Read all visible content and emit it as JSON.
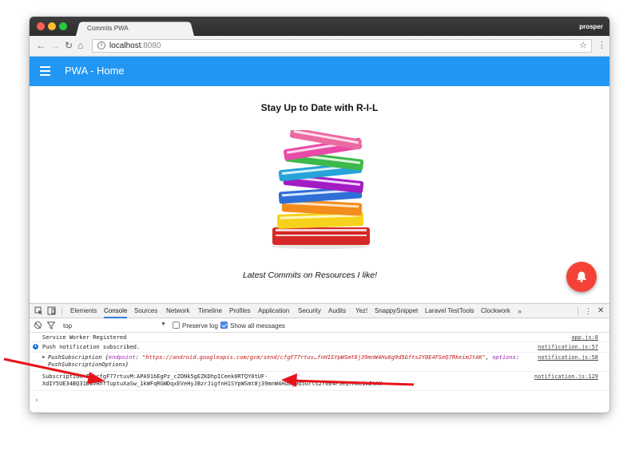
{
  "window": {
    "tab_title": "Commits PWA",
    "profile_name": "prosper"
  },
  "toolbar": {
    "url_host": "localhost",
    "url_port": ":8080"
  },
  "app": {
    "title": "PWA - Home",
    "accent_color": "#2196f3",
    "fab_color": "#f44336",
    "fab_icon": "bell-icon"
  },
  "page": {
    "heading": "Stay Up to Date with R-I-L",
    "tagline": "Latest Commits on Resources I like!"
  },
  "devtools": {
    "tabs": [
      "Elements",
      "Console",
      "Sources",
      "Network",
      "Timeline",
      "Profiles",
      "Application",
      "Security",
      "Audits",
      "Yez!",
      "SnappySnippet",
      "Laravel TestTools",
      "Clockwork"
    ],
    "active_tab": "Console",
    "more": "»",
    "filter": {
      "context": "top",
      "preserve_log": "Preserve log",
      "preserve_log_checked": false,
      "show_all": "Show all messages",
      "show_all_checked": true
    },
    "logs": [
      {
        "message": "Service Worker Registered",
        "source": "app.js:8"
      },
      {
        "message": "Push notification subscribed.",
        "source": "notification.js:57",
        "level": "info"
      },
      {
        "prefix": "PushSubscription {",
        "key1": "endpoint",
        "value1": "\"https://android.googleapis.com/gcm/send/cfgF77rtuv…fnH1SYpWSmt8j39mnW4Hu8g9d5Gfts2Y0E4FSeQ7RkeimJtAK\"",
        "key2": "options",
        "line2": "PushSubscriptionOptions}",
        "source": "notification.js:58"
      },
      {
        "line1": "Subscription ID cfgF77rtuvM:APA91bEgPz_cZONk5gEZKDhpICeek0RTQY0tUF-",
        "line2": "XdIY5UE34BQ31DWvHhfTuptuXaSw_1kWFqRGWDqxEVeHyJBzrJigfnH1SYpWSmt8j39mnW4Hu8g9d5Gfts2Y0E4FSeQ7RkeimJtAK",
        "source": "notification.js:129"
      }
    ],
    "prompt": "›"
  }
}
